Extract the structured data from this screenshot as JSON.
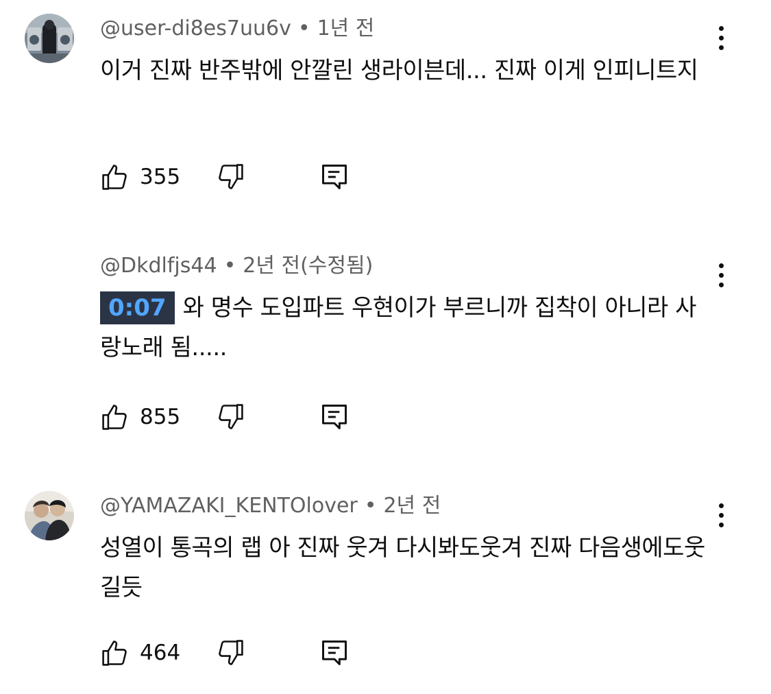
{
  "comments": [
    {
      "author": "@user-di8es7uu6v",
      "time": "1년 전",
      "edited": "",
      "timestamp": "",
      "text": "이거 진짜 반주밖에 안깔린 생라이븐데... 진짜 이게 인피니트지",
      "likes": "355",
      "has_avatar": true
    },
    {
      "author": "@Dkdlfjs44",
      "time": "2년 전",
      "edited": "(수정됨)",
      "timestamp": "0:07",
      "text": "와 명수 도입파트 우현이가 부르니까 집착이 아니라 사랑노래 됨.....",
      "likes": "855",
      "has_avatar": false
    },
    {
      "author": "@YAMAZAKI_KENTOlover",
      "time": "2년 전",
      "edited": "",
      "timestamp": "",
      "text": "성열이 통곡의 랩 아 진짜 웃겨 다시봐도웃겨 진짜 다음생에도웃길듯",
      "likes": "464",
      "has_avatar": true
    }
  ],
  "icons": {
    "like": "thumb-up-icon",
    "dislike": "thumb-down-icon",
    "reply": "reply-icon",
    "more": "more-vertical-icon"
  },
  "colors": {
    "text": "#0f0f0f",
    "meta": "#606060",
    "timestamp_bg": "#2a3445",
    "timestamp_fg": "#52a6ff"
  }
}
